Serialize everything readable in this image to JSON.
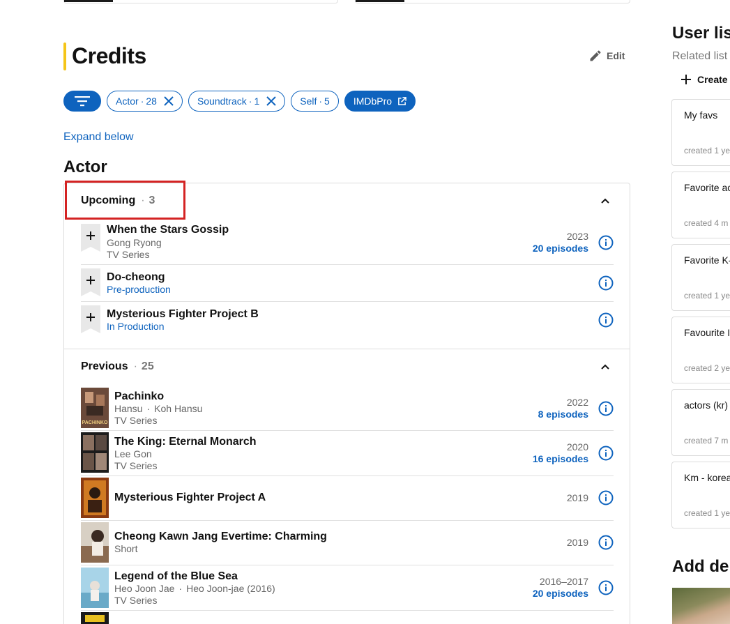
{
  "credits": {
    "title": "Credits",
    "edit_label": "Edit",
    "chips": {
      "actor_label": "Actor",
      "actor_count": "28",
      "soundtrack_label": "Soundtrack",
      "soundtrack_count": "1",
      "self_label": "Self",
      "self_count": "5",
      "imdbpro_label": "IMDbPro"
    },
    "expand_label": "Expand below",
    "section_heading": "Actor",
    "upcoming": {
      "label": "Upcoming",
      "count": "3",
      "items": [
        {
          "title": "When the Stars Gossip",
          "sub1": "Gong Ryong",
          "sub2": "TV Series",
          "year": "2023",
          "episodes": "20 episodes"
        },
        {
          "title": "Do-cheong",
          "status": "Pre-production"
        },
        {
          "title": "Mysterious Fighter Project B",
          "status": "In Production"
        }
      ]
    },
    "previous": {
      "label": "Previous",
      "count": "25",
      "items": [
        {
          "title": "Pachinko",
          "role": "Hansu",
          "role2": "Koh Hansu",
          "type": "TV Series",
          "year": "2022",
          "episodes": "8 episodes",
          "poster_text": "PACHINKO"
        },
        {
          "title": "The King: Eternal Monarch",
          "role": "Lee Gon",
          "type": "TV Series",
          "year": "2020",
          "episodes": "16 episodes"
        },
        {
          "title": "Mysterious Fighter Project A",
          "year": "2019"
        },
        {
          "title": "Cheong Kawn Jang Evertime: Charming",
          "type": "Short",
          "year": "2019"
        },
        {
          "title": "Legend of the Blue Sea",
          "role": "Heo Joon Jae",
          "role2": "Heo Joon-jae (2016)",
          "type": "TV Series",
          "year": "2016–2017",
          "episodes": "20 episodes"
        }
      ]
    }
  },
  "sidebar": {
    "title": "User list",
    "subtitle": "Related list",
    "create_label": "Create",
    "lists": [
      {
        "name": "My favs",
        "created": "created 1 ye"
      },
      {
        "name": "Favorite ac",
        "created": "created 4 m"
      },
      {
        "name": "Favorite K-",
        "created": "created 1 ye"
      },
      {
        "name": "Favourite I",
        "created": "created 2 ye"
      },
      {
        "name": "actors (kr)",
        "created": "created 7 m"
      },
      {
        "name": "Km - korea",
        "created": "created 1 ye"
      }
    ],
    "title2": "Add der"
  },
  "colors": {
    "accent": "#0e63be",
    "brand_yellow": "#f5c518",
    "highlight": "#d42323"
  }
}
